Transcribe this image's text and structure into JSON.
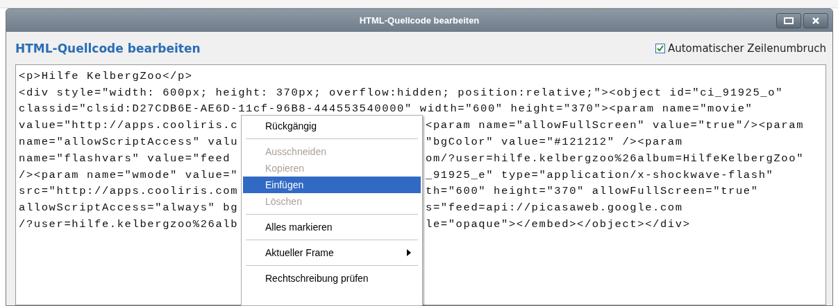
{
  "window": {
    "title": "HTML-Quellcode bearbeiten"
  },
  "heading": "HTML-Quellcode bearbeiten",
  "wrap_option": {
    "label": "Automatischer Zeilenumbruch",
    "checked": true
  },
  "code_lines": [
    {
      "left": "<p>Hilfe KelbergZoo</p>"
    },
    {
      "left": "<div style=\"width: 600px; height: 370px; overflow:hidden; position:relative;\"><object id=\"ci_91925_o\""
    },
    {
      "left": "classid=\"clsid:D27CDB6E-AE6D-11cf-96B8-444553540000\" width=\"600\" height=\"370\"><param name=\"movie\""
    },
    {
      "left": "value=\"http://apps.cooliris.c",
      "right": "<param name=\"allowFullScreen\" value=\"true\"/><param"
    },
    {
      "left": "name=\"allowScriptAccess\" valu",
      "right": "\"bgColor\" value=\"#121212\" /><param"
    },
    {
      "left": "name=\"flashvars\" value=\"feed",
      "right": "om/?user=hilfe.kelbergzoo%26album=HilfeKelbergZoo\""
    },
    {
      "left": "/><param name=\"wmode\" value=\"",
      "right": "_91925_e\" type=\"application/x-shockwave-flash\""
    },
    {
      "left": "src=\"http://apps.cooliris.com",
      "right": "th=\"600\" height=\"370\" allowFullScreen=\"true\""
    },
    {
      "left": "allowScriptAccess=\"always\" bg",
      "right": "s=\"feed=api://picasaweb.google.com"
    },
    {
      "left": "/?user=hilfe.kelbergzoo%26alb",
      "right": "le=\"opaque\"></embed></object></div>"
    }
  ],
  "context_menu": {
    "items": [
      {
        "kind": "item",
        "label": "Rückgängig",
        "disabled": false,
        "selected": false
      },
      {
        "kind": "separator"
      },
      {
        "kind": "item",
        "label": "Ausschneiden",
        "disabled": true,
        "selected": false
      },
      {
        "kind": "item",
        "label": "Kopieren",
        "disabled": true,
        "selected": false
      },
      {
        "kind": "item",
        "label": "Einfügen",
        "disabled": false,
        "selected": true
      },
      {
        "kind": "item",
        "label": "Löschen",
        "disabled": true,
        "selected": false
      },
      {
        "kind": "separator"
      },
      {
        "kind": "item",
        "label": "Alles markieren",
        "disabled": false,
        "selected": false
      },
      {
        "kind": "separator"
      },
      {
        "kind": "submenu",
        "label": "Aktueller Frame",
        "disabled": false,
        "selected": false
      },
      {
        "kind": "separator"
      },
      {
        "kind": "item",
        "label": "Rechtschreibung prüfen",
        "disabled": false,
        "selected": false
      }
    ]
  }
}
